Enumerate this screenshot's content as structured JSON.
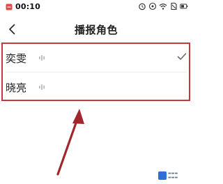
{
  "status_bar": {
    "time": "00:10",
    "left_icons": [
      "notification-icon"
    ],
    "right_icons": [
      "alarm-icon",
      "privacy-icon",
      "wifi-icon",
      "no-sim-icon",
      "battery-icon"
    ]
  },
  "header": {
    "back_icon": "chevron-left-icon",
    "title": "播报角色"
  },
  "options": [
    {
      "label": "奕雯",
      "icon": "voice-icon",
      "selected": true
    },
    {
      "label": "晓亮",
      "icon": "voice-icon",
      "selected": false
    }
  ],
  "annotation": {
    "highlight_color": "#c5393d",
    "arrow_color": "#a0282c"
  },
  "colors": {
    "accent_highlight": "#c5393d",
    "text_primary": "#222222",
    "background": "#ffffff"
  }
}
